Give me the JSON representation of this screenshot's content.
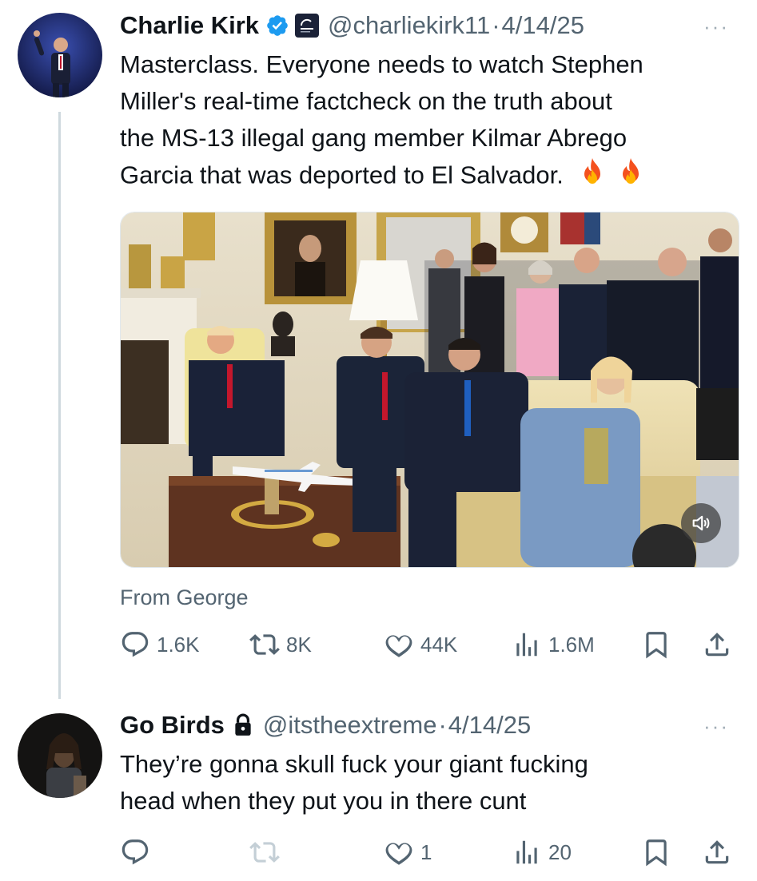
{
  "tweet": {
    "name": "Charlie Kirk",
    "handle": "@charliekirk11",
    "separator": "·",
    "date": "4/14/25",
    "more": "···",
    "text_lines": [
      "Masterclass. Everyone needs to watch Stephen",
      "Miller's real-time factcheck on the truth about",
      "the MS-13 illegal gang member Kilmar Abrego",
      "Garcia that was deported to El Salvador."
    ],
    "emoji": [
      "fire-emoji",
      "fire-emoji"
    ],
    "media_caption": "From George",
    "stats": {
      "replies": "1.6K",
      "reposts": "8K",
      "likes": "44K",
      "views": "1.6M"
    }
  },
  "reply": {
    "name": "Go Birds",
    "handle": "@itstheextreme",
    "separator": "·",
    "date": "4/14/25",
    "more": "···",
    "text_lines": [
      "They’re gonna skull fuck your giant fucking",
      "head when they put you in there cunt"
    ],
    "stats": {
      "replies": "",
      "reposts": "",
      "likes": "1",
      "views": "20"
    }
  },
  "icons": {
    "verified": "verified-badge-icon",
    "affiliate": "affiliate-org-icon",
    "lock": "lock-icon",
    "reply": "reply-icon",
    "repost": "repost-icon",
    "like": "heart-icon",
    "views": "views-icon",
    "bookmark": "bookmark-icon",
    "share": "share-icon",
    "sound": "speaker-icon"
  },
  "colors": {
    "text": "#0f1419",
    "secondary": "#536471",
    "verified": "#1d9bf0",
    "disabled_icon": "#c4cfd6"
  }
}
